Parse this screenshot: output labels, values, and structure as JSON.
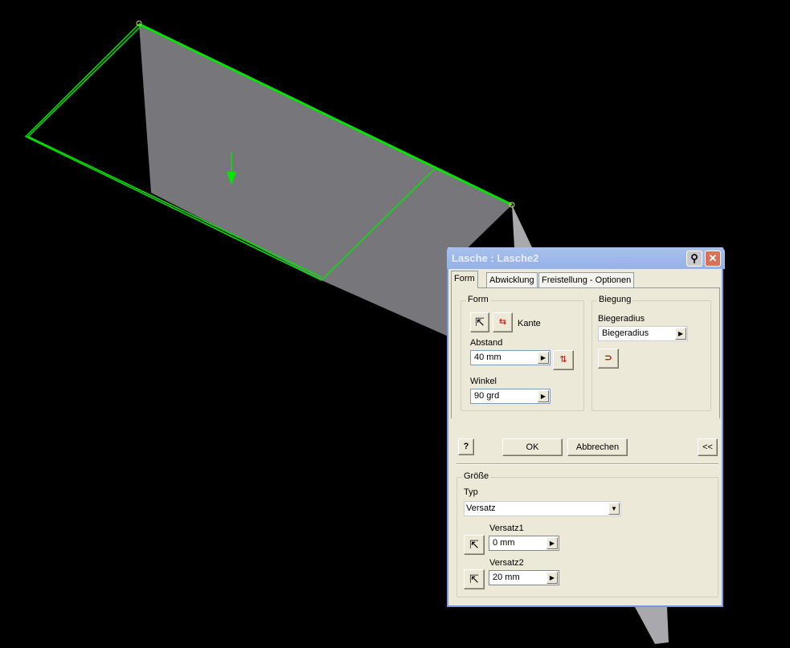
{
  "dialog": {
    "title": "Lasche : Lasche2",
    "pin_icon": "pin-icon",
    "close_icon": "close-icon"
  },
  "tabs": [
    "Form",
    "Abwicklung",
    "Freistellung - Optionen"
  ],
  "form_group": {
    "label": "Form",
    "edge_label": "Kante",
    "abstand_label": "Abstand",
    "abstand_value": "40 mm",
    "winkel_label": "Winkel",
    "winkel_value": "90 grd"
  },
  "biegung_group": {
    "label": "Biegung",
    "radius_label": "Biegeradius",
    "radius_value": "Biegeradius"
  },
  "buttons": {
    "help": "?",
    "ok": "OK",
    "cancel": "Abbrechen",
    "collapse": "<<"
  },
  "groesse_group": {
    "label": "Größe",
    "typ_label": "Typ",
    "typ_value": "Versatz",
    "versatz1_label": "Versatz1",
    "versatz1_value": "0 mm",
    "versatz2_label": "Versatz2",
    "versatz2_value": "20 mm"
  },
  "colors": {
    "highlight": "#00ff00",
    "face": "#77767b"
  }
}
